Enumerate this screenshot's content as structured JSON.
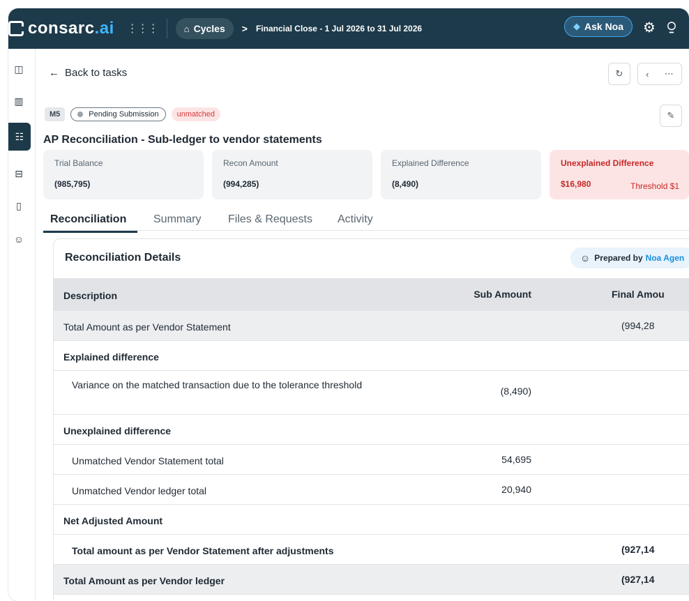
{
  "topbar": {
    "brand": "consarc",
    "brand_dot": ".",
    "brand_tld": "ai",
    "cycles_label": "Cycles",
    "breadcrumb_arrow": ">",
    "breadcrumb": "Financial Close - 1 Jul 2026 to 31 Jul 2026",
    "ask_label": "Ask Noa"
  },
  "page": {
    "back_label": "Back to tasks",
    "code": "M5",
    "status": "Pending Submission",
    "match_state": "unmatched",
    "title": "AP Reconciliation - Sub-ledger to vendor statements"
  },
  "cards": [
    {
      "label": "Trial Balance",
      "value": "(985,795)"
    },
    {
      "label": "Recon Amount",
      "value": "(994,285)"
    },
    {
      "label": "Explained Difference",
      "value": "(8,490)"
    },
    {
      "label": "Unexplained Difference",
      "value": "$16,980",
      "threshold": "Threshold $1"
    }
  ],
  "tabs": [
    "Reconciliation",
    "Summary",
    "Files & Requests",
    "Activity"
  ],
  "details": {
    "title": "Reconciliation Details",
    "prepared_by": "Prepared by",
    "agent": "Noa Agen",
    "columns": [
      "Description",
      "Sub Amount",
      "Final Amou"
    ],
    "rows": [
      {
        "desc": "Total Amount as per Vendor Statement",
        "sub": "",
        "final": "(994,28"
      },
      {
        "desc": "Explained difference",
        "sub": "",
        "final": ""
      },
      {
        "desc": "Variance on the matched transaction due to the tolerance threshold",
        "sub": "(8,490)",
        "final": ""
      },
      {
        "desc": "Unexplained difference",
        "sub": "",
        "final": ""
      },
      {
        "desc": "Unmatched Vendor Statement total",
        "sub": "54,695",
        "final": ""
      },
      {
        "desc": "Unmatched Vendor ledger total",
        "sub": "20,940",
        "final": ""
      },
      {
        "desc": "Net Adjusted Amount",
        "sub": "",
        "final": ""
      },
      {
        "desc": "Total amount as per Vendor Statement after adjustments",
        "sub": "",
        "final": "(927,14"
      },
      {
        "desc": "Total Amount as per Vendor ledger",
        "sub": "",
        "final": "(927,14"
      }
    ]
  },
  "icons": {
    "grid": "apps-grid-icon",
    "home": "home-icon",
    "spark": "sparkle-icon",
    "gear": "gear-icon",
    "refresh": "refresh-icon",
    "chevron": "chevron-left-icon",
    "more": "more-horizontal-icon",
    "edit": "pencil-icon",
    "bot": "bot-icon"
  },
  "colors": {
    "topbar": "#1d3a4a",
    "accent": "#3fa8f2",
    "danger": "#c62828",
    "danger_bg": "#fde4e4"
  }
}
